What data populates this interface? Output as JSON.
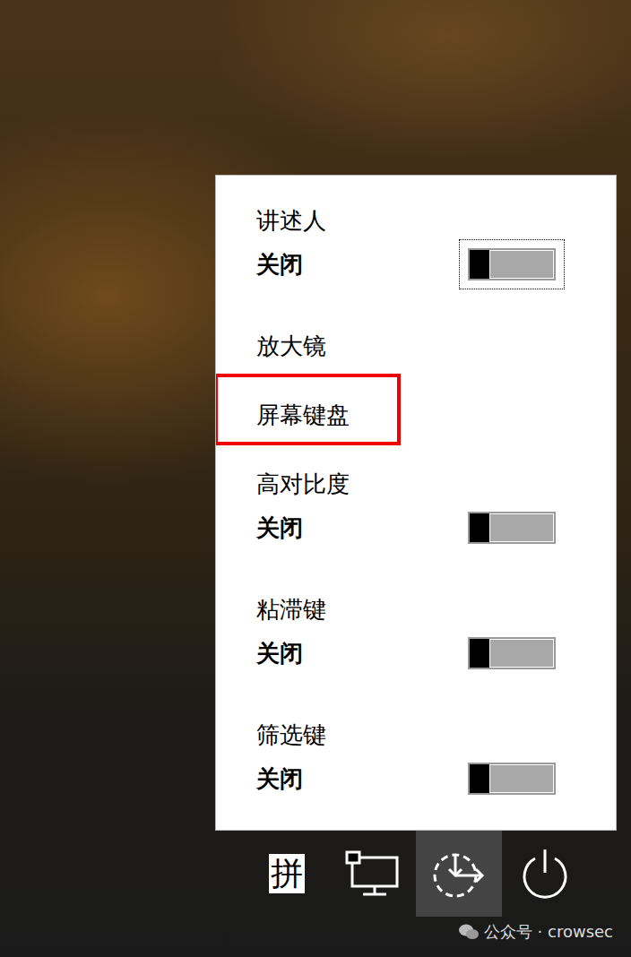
{
  "menu": {
    "items": [
      {
        "label": "讲述人",
        "kind": "toggle",
        "state": "关闭",
        "on": false,
        "focused": true,
        "highlighted": false
      },
      {
        "label": "放大镜",
        "kind": "button",
        "focused": false,
        "highlighted": false
      },
      {
        "label": "屏幕键盘",
        "kind": "button",
        "focused": false,
        "highlighted": true
      },
      {
        "label": "高对比度",
        "kind": "toggle",
        "state": "关闭",
        "on": false,
        "focused": false,
        "highlighted": false
      },
      {
        "label": "粘滞键",
        "kind": "toggle",
        "state": "关闭",
        "on": false,
        "focused": false,
        "highlighted": false
      },
      {
        "label": "筛选键",
        "kind": "toggle",
        "state": "关闭",
        "on": false,
        "focused": false,
        "highlighted": false
      }
    ]
  },
  "taskbar": {
    "buttons": [
      {
        "kind": "ime",
        "label": "拼",
        "selected": false
      },
      {
        "kind": "network",
        "selected": false
      },
      {
        "kind": "ease",
        "selected": true
      },
      {
        "kind": "power",
        "selected": false
      }
    ]
  },
  "watermark": "公众号 · crowsec"
}
